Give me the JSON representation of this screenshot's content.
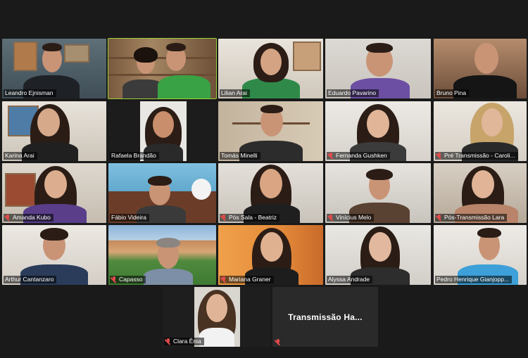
{
  "participants": [
    {
      "name": "Leandro Ejnisman",
      "muted": false
    },
    {
      "name": "",
      "muted": false
    },
    {
      "name": "Lilian Arai",
      "muted": false
    },
    {
      "name": "Eduardo Pavarino",
      "muted": false
    },
    {
      "name": "Bruno Pina",
      "muted": false
    },
    {
      "name": "Karina Arai",
      "muted": false
    },
    {
      "name": "Rafaela Brandão",
      "muted": false
    },
    {
      "name": "Tomás Minelli",
      "muted": false
    },
    {
      "name": "Fernanda Gushken",
      "muted": true
    },
    {
      "name": "Pré Transmissão - Caroli...",
      "muted": true
    },
    {
      "name": "Amanda Kubo",
      "muted": true
    },
    {
      "name": "Fábio Videira",
      "muted": false
    },
    {
      "name": "Pós Sala - Beatriz",
      "muted": true
    },
    {
      "name": "Vinícius Melo",
      "muted": true
    },
    {
      "name": "Pós-Transmissão Lara",
      "muted": true
    },
    {
      "name": "Arthur Cantanzaro",
      "muted": false
    },
    {
      "name": "Capasso",
      "muted": true
    },
    {
      "name": "Mariana Graner",
      "muted": true
    },
    {
      "name": "Alyssa Andrade",
      "muted": false
    },
    {
      "name": "Pedro Henrique Gianjopp...",
      "muted": false
    },
    {
      "name": "Clara Ênia",
      "muted": true
    },
    {
      "name": "",
      "muted": true
    }
  ],
  "screen_share_tile": {
    "label": "Transmissão  Ha..."
  },
  "colors": {
    "active_speaker": "#9bd13a",
    "muted_icon": "#e14b4b",
    "background": "#1a1a1a"
  }
}
